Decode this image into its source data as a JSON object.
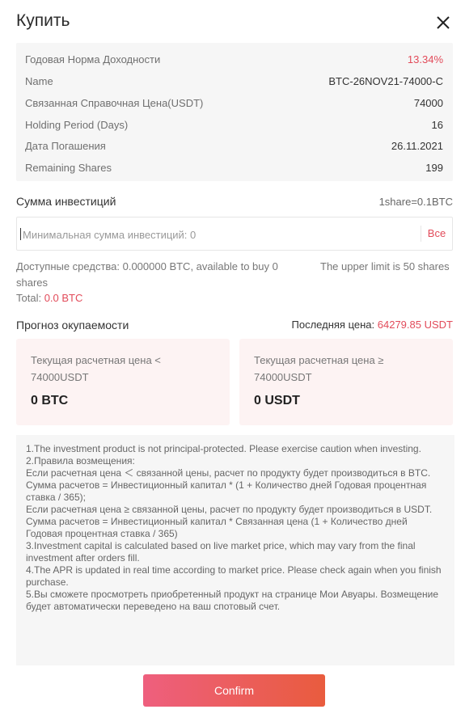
{
  "dialog": {
    "title": "Купить",
    "close_icon": "close-icon"
  },
  "info": {
    "rows": [
      {
        "label": "Годовая Норма Доходности",
        "value": "13.34%"
      },
      {
        "label": "Name",
        "value": "BTC-26NOV21-74000-C"
      },
      {
        "label": "Связанная Справочная Цена(USDT)",
        "value": "74000"
      },
      {
        "label": "Holding Period (Days)",
        "value": "16"
      },
      {
        "label": "Дата Погашения",
        "value": "26.11.2021"
      },
      {
        "label": "Remaining Shares",
        "value": "199"
      }
    ]
  },
  "investment": {
    "label": "Сумма инвестиций",
    "share_rate": "1share=0.1BTC",
    "placeholder": "Минимальная сумма инвестиций: 0",
    "value": "",
    "all_button": "Все"
  },
  "available": {
    "text": "Доступные средства: 0.000000 BTC, available to buy 0 shares",
    "upper_limit": "The upper limit is 50 shares",
    "total_label": "Total:",
    "total_value": "0.0 BTC"
  },
  "forecast": {
    "label": "Прогноз окупаемости",
    "last_price_label": "Последняя цена:",
    "last_price_value": "64279.85 USDT",
    "cards": [
      {
        "condition": "Текущая расчетная цена < 74000USDT",
        "amount": "0 BTC"
      },
      {
        "condition": "Текущая расчетная цена ≥ 74000USDT",
        "amount": "0 USDT"
      }
    ]
  },
  "notes": [
    "1.The investment product is not principal-protected. Please exercise caution when investing.",
    "2.Правила возмещения:",
    "Если расчетная цена ＜ связанной цены, расчет по продукту будет производиться в BTC. Сумма расчетов = Инвестиционный капитал * (1 + Количество дней Годовая процентная ставка / 365);",
    "Если расчетная цена ≥ связанной цены, расчет по продукту будет производиться в USDT. Сумма расчетов = Инвестиционный капитал * Связанная цена (1 + Количество дней Годовая процентная ставка / 365)",
    "3.Investment capital is calculated based on live market price, which may vary from the final investment after orders fill.",
    "4.The APR is updated in real time according to market price. Please check again when you finish purchase.",
    "5.Вы сможете просмотреть приобретенный продукт на странице Мои Авуары. Возмещение будет автоматически переведено на ваш спотовый счет."
  ],
  "confirm_label": "Confirm",
  "colors": {
    "accent": "#e24b5a",
    "button_start": "#ee5f7e",
    "button_end": "#e95c3e"
  }
}
